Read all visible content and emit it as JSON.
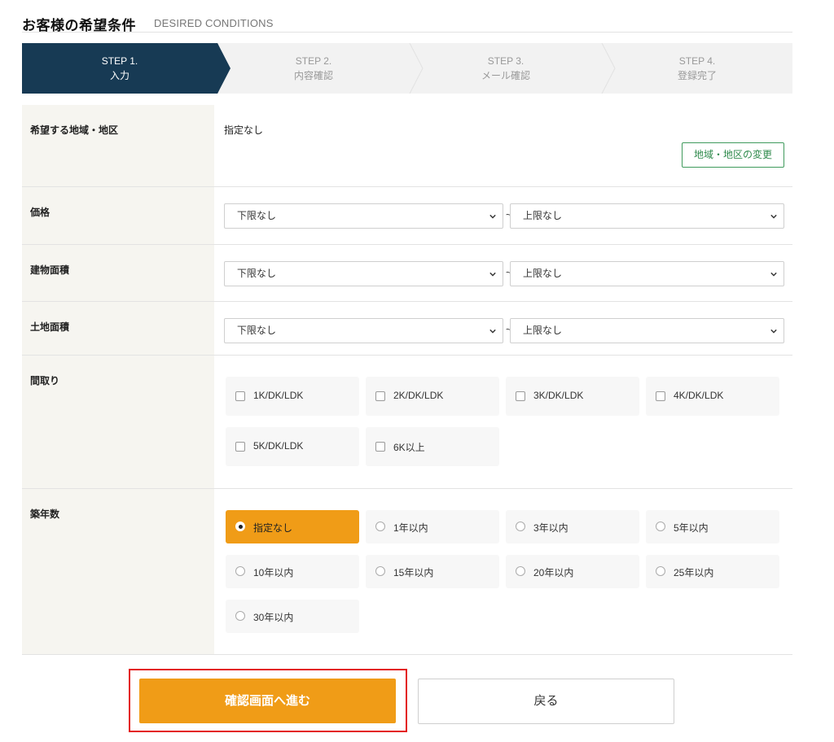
{
  "header": {
    "title_ja": "お客様の希望条件",
    "title_en": "DESIRED CONDITIONS"
  },
  "steps": [
    {
      "num": "STEP 1.",
      "label": "入力"
    },
    {
      "num": "STEP 2.",
      "label": "内容確認"
    },
    {
      "num": "STEP 3.",
      "label": "メール確認"
    },
    {
      "num": "STEP 4.",
      "label": "登録完了"
    }
  ],
  "form": {
    "area": {
      "label": "希望する地域・地区",
      "value": "指定なし",
      "change_button": "地域・地区の変更"
    },
    "price": {
      "label": "価格",
      "min": "下限なし",
      "max": "上限なし"
    },
    "building_area": {
      "label": "建物面積",
      "min": "下限なし",
      "max": "上限なし"
    },
    "land_area": {
      "label": "土地面積",
      "min": "下限なし",
      "max": "上限なし"
    },
    "tilde": "~",
    "layout": {
      "label": "間取り",
      "options": [
        "1K/DK/LDK",
        "2K/DK/LDK",
        "3K/DK/LDK",
        "4K/DK/LDK",
        "5K/DK/LDK",
        "6K以上"
      ]
    },
    "age": {
      "label": "築年数",
      "selected": "指定なし",
      "options": [
        "指定なし",
        "1年以内",
        "3年以内",
        "5年以内",
        "10年以内",
        "15年以内",
        "20年以内",
        "25年以内",
        "30年以内"
      ]
    }
  },
  "actions": {
    "confirm": "確認画面へ進む",
    "back": "戻る"
  },
  "colors": {
    "step_active": "#173a54",
    "accent_orange": "#f09c17",
    "change_button_green": "#3f9a5c",
    "highlight_red": "#e31b1b"
  }
}
